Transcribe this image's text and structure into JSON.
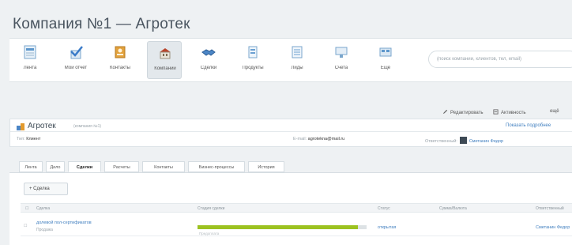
{
  "page": {
    "title": "Компания №1 — Агротек"
  },
  "toolbar": {
    "items": [
      {
        "label": "Лента",
        "icon": "news-feed-icon",
        "active": false
      },
      {
        "label": "Мой отчет",
        "icon": "report-check-icon",
        "active": false
      },
      {
        "label": "Контакты",
        "icon": "contact-card-icon",
        "active": false
      },
      {
        "label": "Компании",
        "icon": "company-building-icon",
        "active": true
      },
      {
        "label": "Сделки",
        "icon": "handshake-icon",
        "active": false
      },
      {
        "label": "Продукты",
        "icon": "products-icon",
        "active": false
      },
      {
        "label": "Лиды",
        "icon": "leads-icon",
        "active": false
      },
      {
        "label": "Счета",
        "icon": "invoice-icon",
        "active": false
      },
      {
        "label": "Ещё",
        "icon": "more-apps-icon",
        "active": false
      }
    ],
    "search_placeholder": "(поиск компании, клиентов, тел, email)"
  },
  "actions": {
    "edit_label": "Редактировать",
    "activity_label": "Активность",
    "more_label": "ещё"
  },
  "company": {
    "name": "Агротек",
    "subtitle": "(компания №1)",
    "more_link": "Показать подробнее",
    "type_label": "Тип:",
    "type_value": "Клиент",
    "email_label": "E-mail:",
    "email_value": "agrotekna@mail.ru",
    "responsible_label": "Ответственный:",
    "responsible_value": "Сметанин Федор"
  },
  "tabs": [
    {
      "label": "Лента",
      "active": false
    },
    {
      "label": "Дело",
      "active": false
    },
    {
      "label": "Сделки",
      "active": true
    },
    {
      "label": "Расчеты",
      "active": false
    },
    {
      "label": "Контакты",
      "active": false
    },
    {
      "label": "Бизнес-процессы",
      "active": false
    },
    {
      "label": "История",
      "active": false
    }
  ],
  "deals": {
    "add_button": "+ Сделка",
    "columns": [
      "Сделка",
      "Стадия сделки",
      "Статус",
      "Сумма/Валюта",
      "Ответственный"
    ],
    "rows": [
      {
        "name": "долевой пол-сертификатов",
        "sub": "Продажа",
        "stage_label": "Предоплата",
        "stage_progress": 0.95,
        "status": "открытая",
        "amount": "",
        "responsible": "Сметанин Федор"
      }
    ]
  },
  "colors": {
    "accent": "#3f7ebf",
    "stage_fill": "#9cc220",
    "active_tab_bg": "#ffffff"
  }
}
